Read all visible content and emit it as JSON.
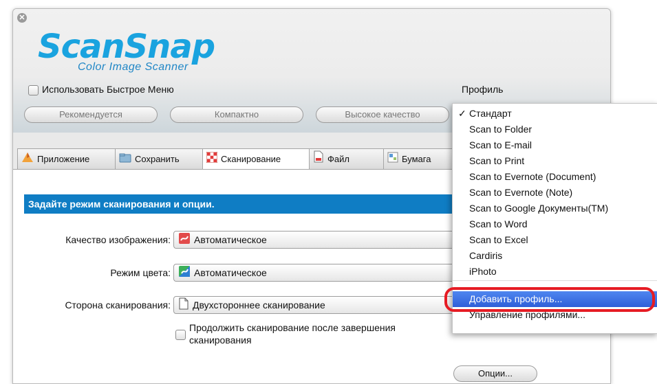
{
  "window": {
    "close_glyph": "✕",
    "logo_main": "ScanSnap",
    "logo_sub": "Color Image Scanner"
  },
  "quick_menu": {
    "checked": false,
    "label": "Использовать Быстрое Меню"
  },
  "profile": {
    "label": "Профиль"
  },
  "presets": [
    "Рекомендуется",
    "Компактно",
    "Высокое качество"
  ],
  "tabs": [
    {
      "label": "Приложение",
      "icon": "app-icon"
    },
    {
      "label": "Сохранить",
      "icon": "folder-icon"
    },
    {
      "label": "Сканирование",
      "icon": "scan-icon",
      "active": true
    },
    {
      "label": "Файл",
      "icon": "file-icon"
    },
    {
      "label": "Бумага",
      "icon": "paper-icon"
    }
  ],
  "scan_panel": {
    "header": "Задайте режим сканирования и опции.",
    "rows": [
      {
        "label": "Качество изображения:",
        "value": "Автоматическое",
        "icon": "quality-icon"
      },
      {
        "label": "Режим цвета:",
        "value": "Автоматическое",
        "icon": "color-mode-icon"
      },
      {
        "label": "Сторона сканирования:",
        "value": "Двухстороннее сканирование",
        "icon": "page-icon"
      }
    ],
    "continue_scan": {
      "checked": false,
      "line1": "Продолжить сканирование после завершения",
      "line2": "сканирования"
    },
    "options_button": "Опции..."
  },
  "profile_menu": {
    "check_mark": "✓",
    "items": [
      {
        "label": "Стандарт",
        "checked": true
      },
      {
        "label": "Scan to Folder"
      },
      {
        "label": "Scan to E-mail"
      },
      {
        "label": "Scan to Print"
      },
      {
        "label": "Scan to Evernote (Document)"
      },
      {
        "label": "Scan to Evernote (Note)"
      },
      {
        "label": "Scan to Google Документы(TM)"
      },
      {
        "label": "Scan to Word"
      },
      {
        "label": "Scan to Excel"
      },
      {
        "label": "Cardiris"
      },
      {
        "label": "iPhoto"
      }
    ],
    "add_profile": "Добавить профиль...",
    "manage_profiles": "Управление профилями..."
  },
  "colors": {
    "accent": "#0f7dc4",
    "highlight": "#3a6fe0",
    "callout": "#e61c24",
    "logo": "#1aa3df"
  }
}
